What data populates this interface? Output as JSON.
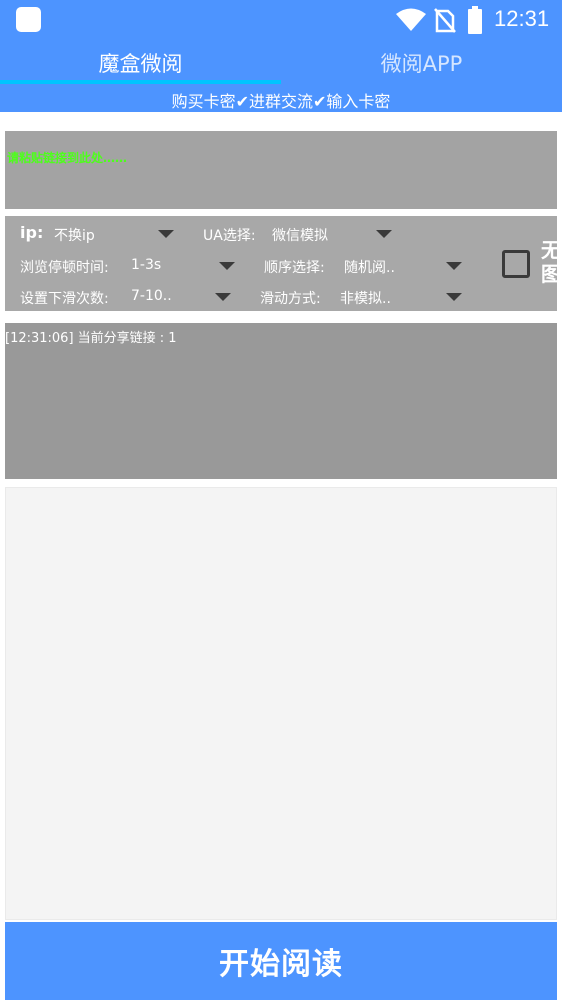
{
  "status_bar": {
    "time": "12:31",
    "icons": [
      "app-icon",
      "wifi-icon",
      "no-sim-icon",
      "battery-icon"
    ]
  },
  "tabs": [
    {
      "label": "魔盒微阅",
      "active": true
    },
    {
      "label": "微阅APP",
      "active": false
    }
  ],
  "subline": "购买卡密✔进群交流✔输入卡密",
  "info_panel": {
    "text": "请粘贴链接到此处……"
  },
  "settings": {
    "ip_label": "ip:",
    "ip_value": "不换ip",
    "ua_label": "UA选择:",
    "ua_value": "微信模拟",
    "browse_pause_label": "浏览停顿时间:",
    "browse_pause_value": "1-3s",
    "order_label": "顺序选择:",
    "order_value": "随机阅..",
    "scroll_count_label": "设置下滑次数:",
    "scroll_count_value": "7-10..",
    "scroll_mode_label": "滑动方式:",
    "scroll_mode_value": "非模拟..",
    "no_image_label": "无图",
    "no_image_checked": false
  },
  "log": {
    "lines": [
      "[12:31:06] 当前分享链接 : 1"
    ]
  },
  "start_button": "开始阅读",
  "colors": {
    "primary": "#4d94ff",
    "indicator": "#00c4ff",
    "panel_gray": "#a8a8a8",
    "green_text": "#4dff1a"
  }
}
